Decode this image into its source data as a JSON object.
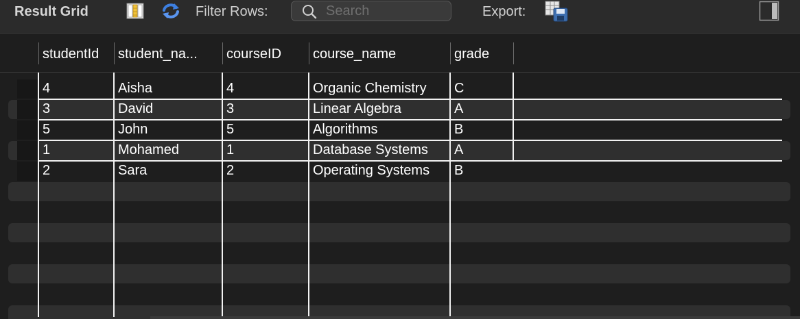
{
  "toolbar": {
    "title": "Result Grid",
    "filter_label": "Filter Rows:",
    "search_placeholder": "Search",
    "search_value": "",
    "export_label": "Export:",
    "icons": {
      "columns": "columns-icon",
      "refresh": "refresh-icon",
      "search": "search-icon",
      "export": "export-icon",
      "panel": "panel-toggle-icon"
    }
  },
  "grid": {
    "columns": [
      "studentId",
      "student_na...",
      "courseID",
      "course_name",
      "grade"
    ],
    "rows": [
      [
        "4",
        "Aisha",
        "4",
        "Organic Chemistry",
        "C"
      ],
      [
        "3",
        "David",
        "3",
        "Linear Algebra",
        "A"
      ],
      [
        "5",
        "John",
        "5",
        "Algorithms",
        "B"
      ],
      [
        "1",
        "Mohamed",
        "1",
        "Database Systems",
        "A"
      ],
      [
        "2",
        "Sara",
        "2",
        "Operating Systems",
        "B"
      ]
    ]
  },
  "colors": {
    "background": "#1e1e1e",
    "toolbar": "#2b2b2b",
    "accent_refresh": "#3d7fe0",
    "grid_lines": "#f2f2f2",
    "stripe": "#2f2f2f"
  }
}
